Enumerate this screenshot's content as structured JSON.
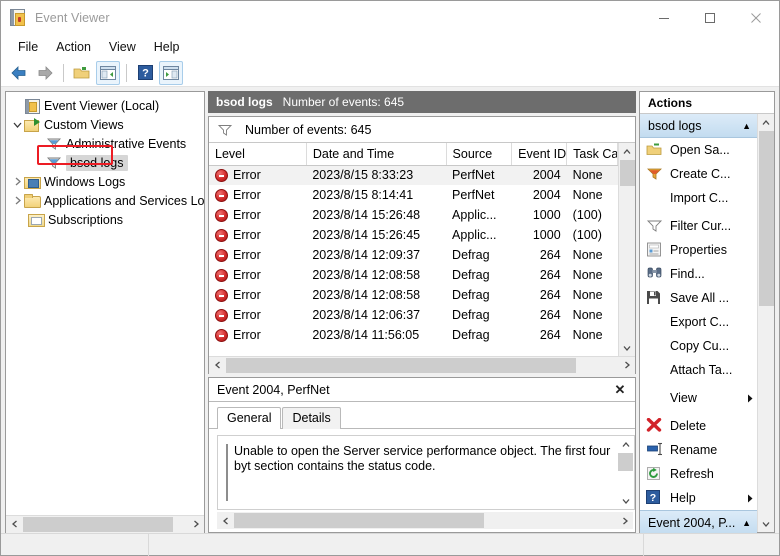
{
  "window": {
    "title": "Event Viewer",
    "icon": "event-viewer-icon",
    "controls": {
      "minimize": "—",
      "maximize": "□",
      "close": "✕"
    }
  },
  "menubar": {
    "items": [
      "File",
      "Action",
      "View",
      "Help"
    ]
  },
  "toolbar": {
    "items": [
      {
        "name": "back-button",
        "glyph": "back-arrow-icon"
      },
      {
        "name": "forward-button",
        "glyph": "forward-arrow-icon"
      },
      {
        "name": "show-hide-console-tree-button",
        "glyph": "folder-open-icon"
      },
      {
        "name": "properties-button",
        "glyph": "window-left-icon"
      },
      {
        "name": "help-button",
        "glyph": "question-mark-icon"
      },
      {
        "name": "show-hide-action-pane-button",
        "glyph": "window-right-icon"
      }
    ]
  },
  "tree": {
    "items": [
      {
        "label": "Event Viewer (Local)",
        "indent": 1,
        "twisty": "none",
        "icon": "book-icon",
        "selected": false
      },
      {
        "label": "Custom Views",
        "indent": 1,
        "twisty": "expanded",
        "icon": "folder-arrow-icon",
        "selected": false
      },
      {
        "label": "Administrative Events",
        "indent": 3,
        "twisty": "none",
        "icon": "funnel-icon",
        "selected": false
      },
      {
        "label": "bsod logs",
        "indent": 3,
        "twisty": "none",
        "icon": "funnel-icon",
        "selected": true
      },
      {
        "label": "Windows Logs",
        "indent": 1,
        "twisty": "collapsed",
        "icon": "monitor-folder-icon",
        "selected": false
      },
      {
        "label": "Applications and Services Lo",
        "indent": 1,
        "twisty": "collapsed",
        "icon": "folder-icon",
        "selected": false
      },
      {
        "label": "Subscriptions",
        "indent": 1,
        "twisty": "none",
        "icon": "subscriptions-icon",
        "selected": false
      }
    ],
    "highlight": {
      "label": "bsod logs",
      "color": "#ec1c24"
    }
  },
  "main": {
    "pane_title": {
      "name": "bsod logs",
      "count_text": "Number of events: 645"
    },
    "filter_bar": {
      "icon": "funnel-icon",
      "text": "Number of events: 645"
    },
    "table": {
      "columns": [
        "Level",
        "Date and Time",
        "Source",
        "Event ID",
        "Task Ca"
      ],
      "rows": [
        {
          "level": "Error",
          "datetime": "2023/8/15 8:33:23",
          "source": "PerfNet",
          "event_id": "2004",
          "task": "None",
          "selected": true
        },
        {
          "level": "Error",
          "datetime": "2023/8/15 8:14:41",
          "source": "PerfNet",
          "event_id": "2004",
          "task": "None",
          "selected": false
        },
        {
          "level": "Error",
          "datetime": "2023/8/14 15:26:48",
          "source": "Applic...",
          "event_id": "1000",
          "task": "(100)",
          "selected": false
        },
        {
          "level": "Error",
          "datetime": "2023/8/14 15:26:45",
          "source": "Applic...",
          "event_id": "1000",
          "task": "(100)",
          "selected": false
        },
        {
          "level": "Error",
          "datetime": "2023/8/14 12:09:37",
          "source": "Defrag",
          "event_id": "264",
          "task": "None",
          "selected": false
        },
        {
          "level": "Error",
          "datetime": "2023/8/14 12:08:58",
          "source": "Defrag",
          "event_id": "264",
          "task": "None",
          "selected": false
        },
        {
          "level": "Error",
          "datetime": "2023/8/14 12:08:58",
          "source": "Defrag",
          "event_id": "264",
          "task": "None",
          "selected": false
        },
        {
          "level": "Error",
          "datetime": "2023/8/14 12:06:37",
          "source": "Defrag",
          "event_id": "264",
          "task": "None",
          "selected": false
        },
        {
          "level": "Error",
          "datetime": "2023/8/14 11:56:05",
          "source": "Defrag",
          "event_id": "264",
          "task": "None",
          "selected": false
        }
      ]
    },
    "detail": {
      "header": "Event 2004, PerfNet",
      "close_glyph": "✕",
      "tabs": [
        {
          "label": "General",
          "active": true
        },
        {
          "label": "Details",
          "active": false
        }
      ],
      "message": "Unable to open the Server service performance object. The first four byt section contains the status code."
    }
  },
  "actions": {
    "title": "Actions",
    "group_header": {
      "label": "bsod logs",
      "collapse_glyph": "▲"
    },
    "items": [
      {
        "label": "Open Sa...",
        "icon": "open-saved-log-icon",
        "submenu": false,
        "sep_after": false
      },
      {
        "label": "Create C...",
        "icon": "create-custom-view-icon",
        "submenu": false,
        "sep_after": false
      },
      {
        "label": "Import C...",
        "icon": "none",
        "submenu": false,
        "sep_after": true
      },
      {
        "label": "Filter Cur...",
        "icon": "filter-icon",
        "submenu": false,
        "sep_after": false
      },
      {
        "label": "Properties",
        "icon": "properties-icon",
        "submenu": false,
        "sep_after": false
      },
      {
        "label": "Find...",
        "icon": "find-binoculars-icon",
        "submenu": false,
        "sep_after": false
      },
      {
        "label": "Save All ...",
        "icon": "save-icon",
        "submenu": false,
        "sep_after": false
      },
      {
        "label": "Export C...",
        "icon": "none",
        "submenu": false,
        "sep_after": false
      },
      {
        "label": "Copy Cu...",
        "icon": "none",
        "submenu": false,
        "sep_after": false
      },
      {
        "label": "Attach Ta...",
        "icon": "none",
        "submenu": false,
        "sep_after": true
      },
      {
        "label": "View",
        "icon": "none",
        "submenu": true,
        "sep_after": true
      },
      {
        "label": "Delete",
        "icon": "delete-x-icon",
        "submenu": false,
        "sep_after": false
      },
      {
        "label": "Rename",
        "icon": "rename-icon",
        "submenu": false,
        "sep_after": false
      },
      {
        "label": "Refresh",
        "icon": "refresh-icon",
        "submenu": false,
        "sep_after": false
      },
      {
        "label": "Help",
        "icon": "help-icon",
        "submenu": true,
        "sep_after": false
      }
    ],
    "bottom_group": {
      "label": "Event 2004, P...",
      "collapse_glyph": "▲"
    }
  },
  "colors": {
    "pane_title_bg": "#6d6d6d",
    "group_header_bg": "#c3dcf0",
    "error_red": "#d42b2b",
    "highlight_red": "#ec1c24",
    "selection_gray": "#d6d6d6"
  }
}
